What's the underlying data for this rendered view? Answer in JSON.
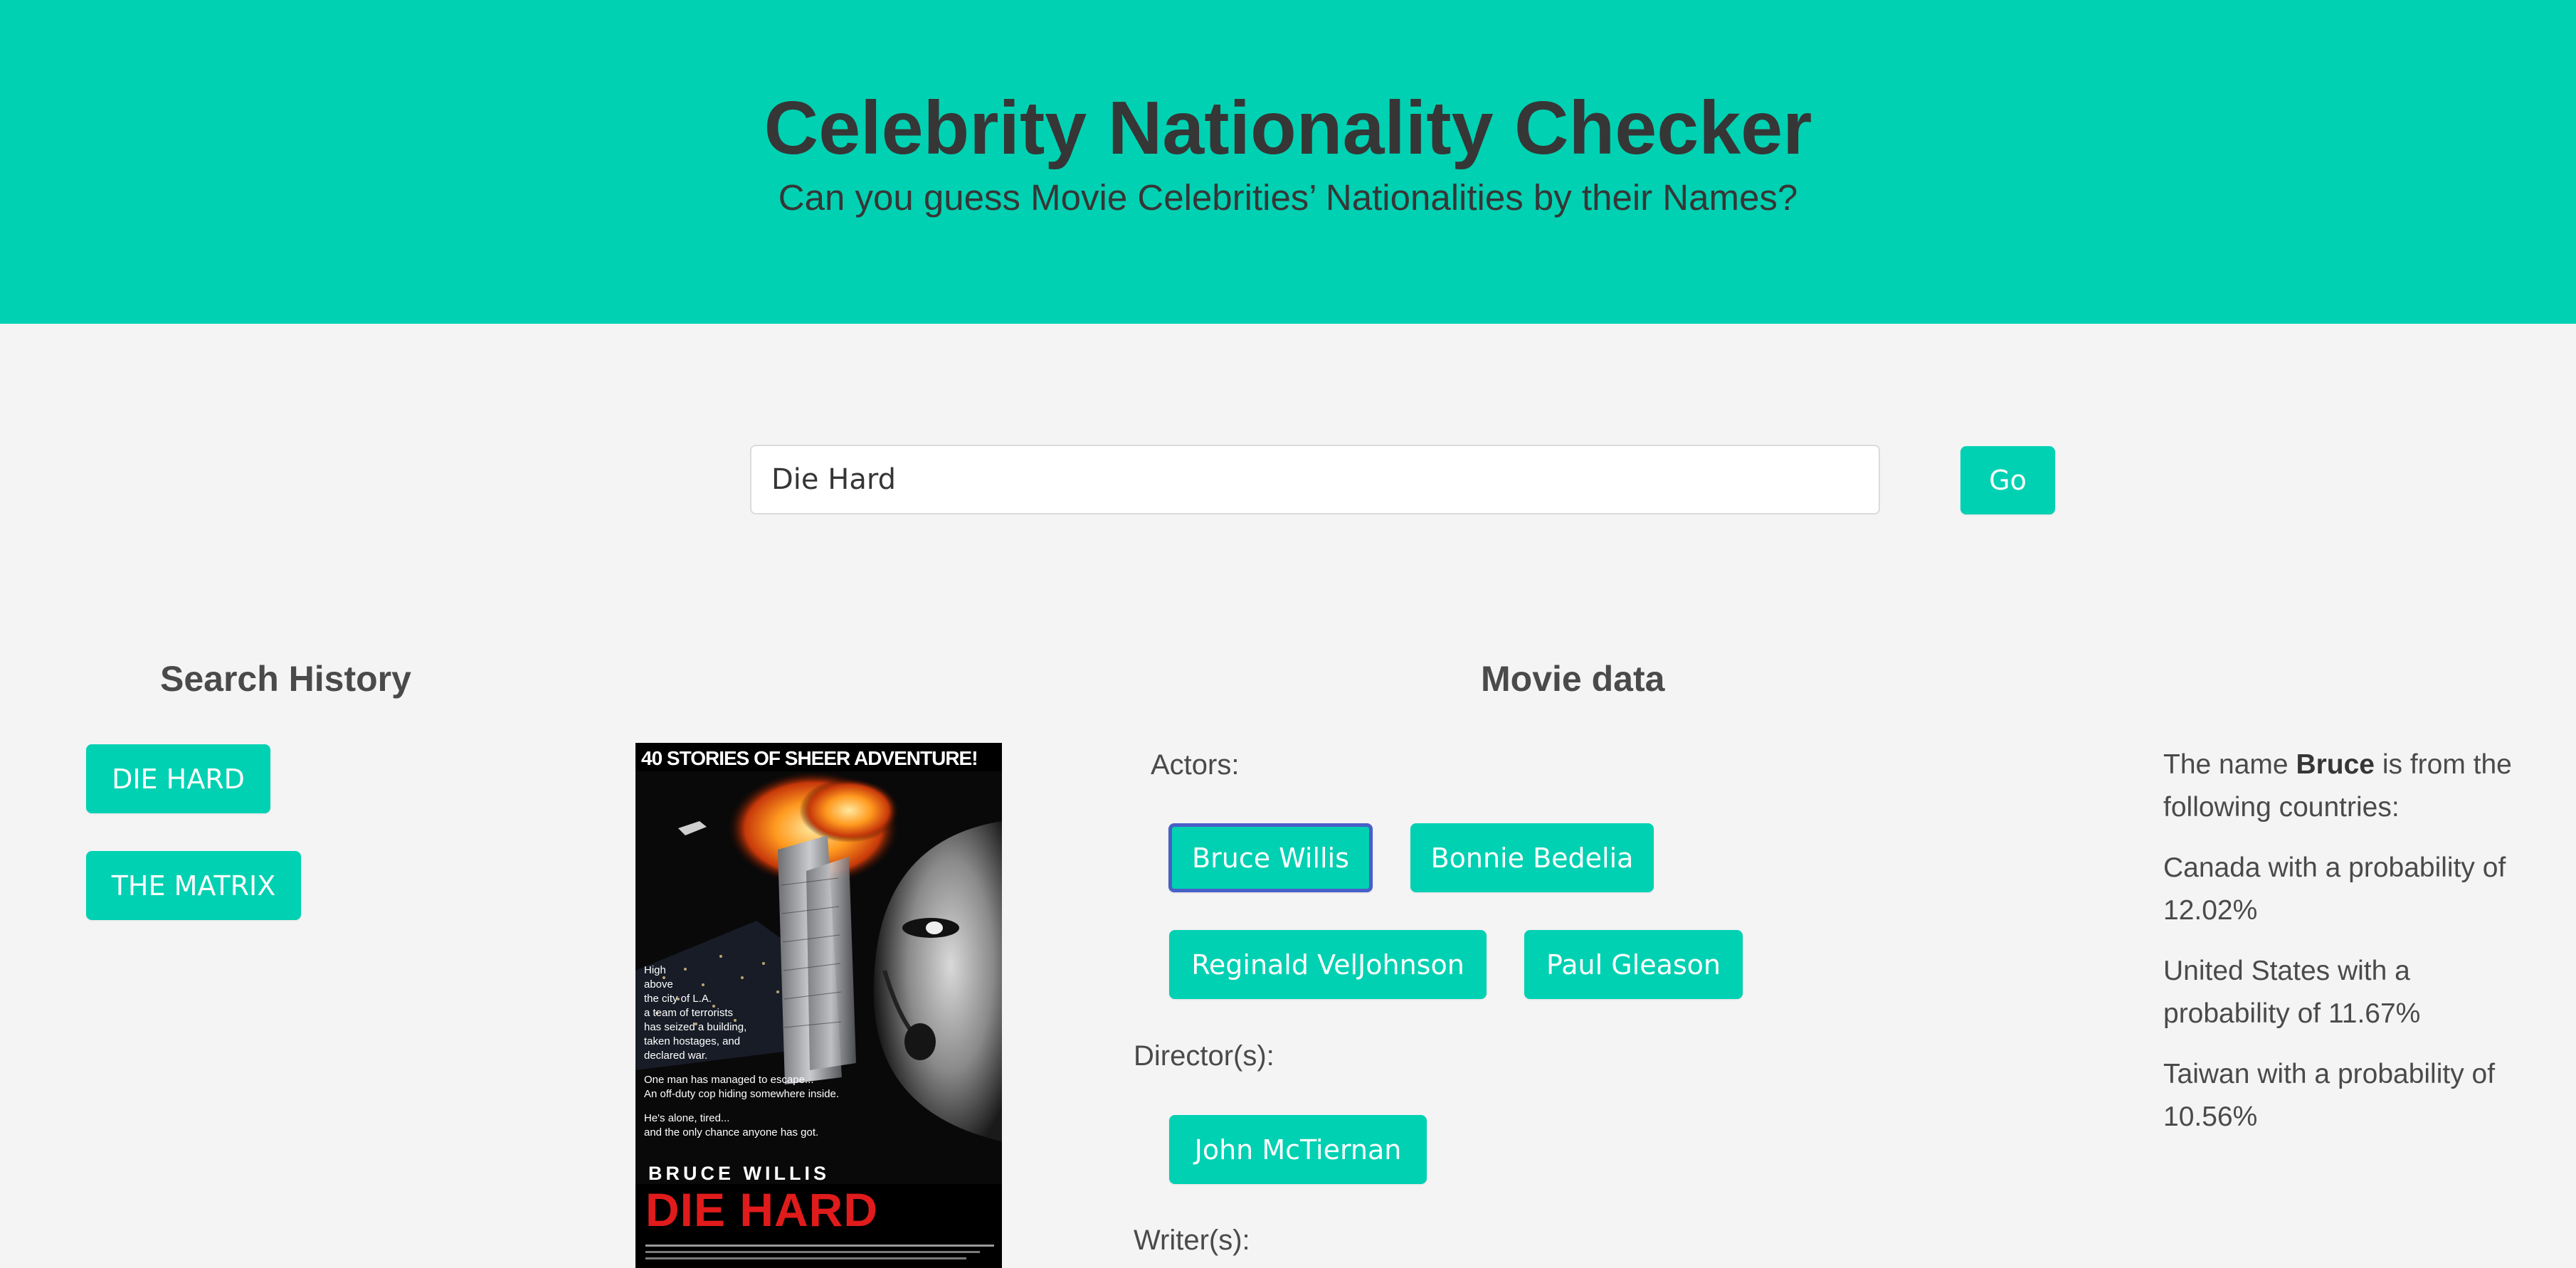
{
  "hero": {
    "title": "Celebrity Nationality Checker",
    "subtitle": "Can you guess Movie Celebrities’ Nationalities by their Names?"
  },
  "search": {
    "value": "Die Hard",
    "go_label": "Go"
  },
  "history": {
    "title": "Search History",
    "items": [
      "DIE HARD",
      "THE MATRIX"
    ]
  },
  "movie": {
    "title": "Movie data",
    "actors_label": "Actors:",
    "actors": [
      "Bruce Willis",
      "Bonnie Bedelia",
      "Reginald VelJohnson",
      "Paul Gleason"
    ],
    "directors_label": "Director(s):",
    "directors": [
      "John McTiernan"
    ],
    "writers_label": "Writer(s):"
  },
  "poster": {
    "tagline": "40 STORIES OF SHEER ADVENTURE!",
    "blurb_lines": [
      "High",
      "above",
      "the city of L.A.",
      "a team of terrorists",
      "has seized a building,",
      "taken hostages, and",
      "declared war."
    ],
    "blurb2_lines": [
      "One man has managed to escape...",
      "An off-duty cop hiding somewhere inside."
    ],
    "blurb3_lines": [
      "He's alone, tired...",
      "and the only chance anyone has got."
    ],
    "star": "BRUCE WILLIS",
    "movie_title": "DIE HARD"
  },
  "nationality": {
    "intro_prefix": "The name ",
    "name": "Bruce",
    "intro_suffix": " is from the following countries:",
    "results": [
      "Canada with a probability of 12.02%",
      "United States with a probability of 11.67%",
      "Taiwan with a probability of 10.56%"
    ]
  },
  "colors": {
    "primary": "#00d1b2",
    "background": "#f4f4f4",
    "text": "#4a4a4a",
    "title_text": "#363636",
    "focus_ring": "#485fc7"
  }
}
